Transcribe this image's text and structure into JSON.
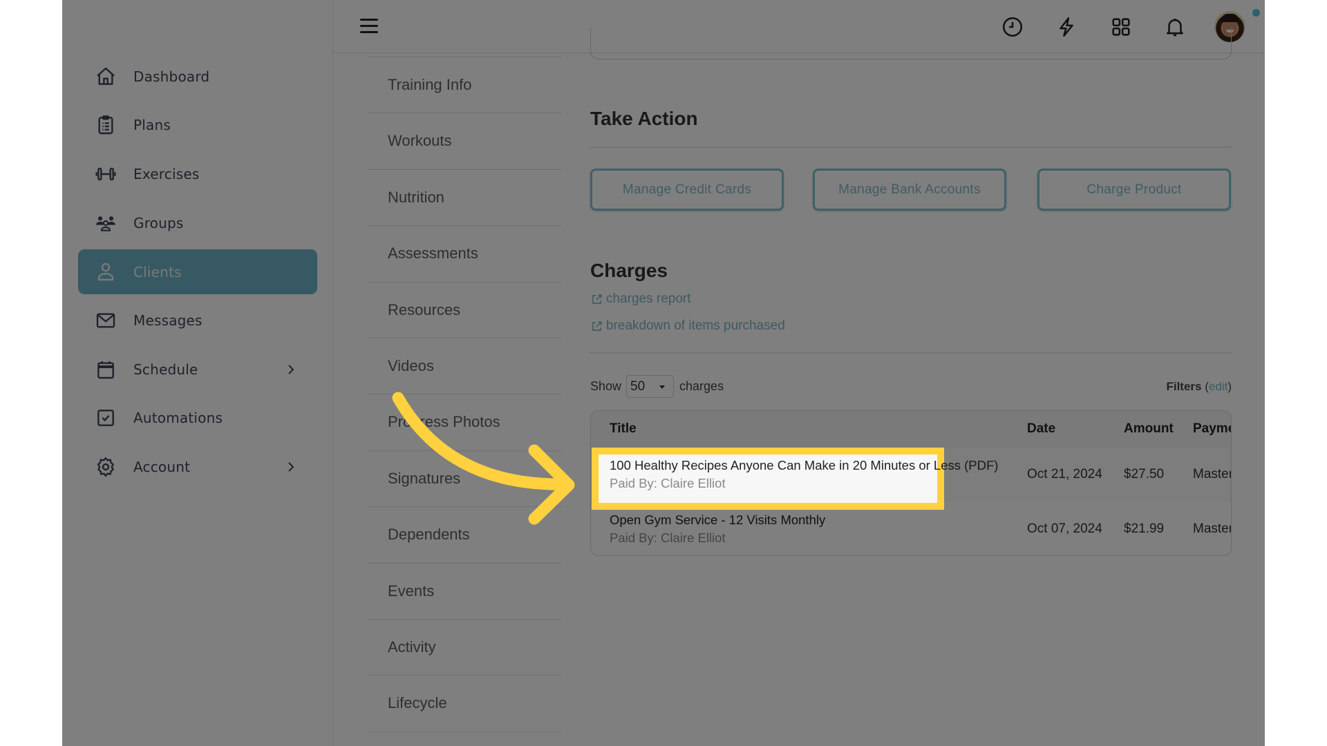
{
  "sidebar": {
    "items": [
      {
        "label": "Dashboard",
        "icon": "home-icon"
      },
      {
        "label": "Plans",
        "icon": "clipboard-icon"
      },
      {
        "label": "Exercises",
        "icon": "dumbbell-icon"
      },
      {
        "label": "Groups",
        "icon": "users-icon"
      },
      {
        "label": "Clients",
        "icon": "user-icon",
        "active": true
      },
      {
        "label": "Messages",
        "icon": "envelope-icon"
      },
      {
        "label": "Schedule",
        "icon": "calendar-icon",
        "has_submenu": true
      },
      {
        "label": "Automations",
        "icon": "checkbox-icon"
      },
      {
        "label": "Account",
        "icon": "gear-icon",
        "has_submenu": true
      }
    ]
  },
  "header": {
    "icons": [
      "menu-icon",
      "clock-icon",
      "lightning-icon",
      "apps-grid-icon",
      "bell-icon"
    ],
    "notification_dot": true
  },
  "subnav": {
    "items": [
      "Training Info",
      "Workouts",
      "Nutrition",
      "Assessments",
      "Resources",
      "Videos",
      "Progress Photos",
      "Signatures",
      "Dependents",
      "Events",
      "Activity",
      "Lifecycle"
    ]
  },
  "take_action": {
    "title": "Take Action",
    "buttons": [
      "Manage Credit Cards",
      "Manage Bank Accounts",
      "Charge Product"
    ]
  },
  "charges": {
    "title": "Charges",
    "links": [
      "charges report",
      "breakdown of items purchased"
    ],
    "show_label": "Show",
    "page_size": "50",
    "page_size_suffix": "charges",
    "filters_label": "Filters",
    "filters_edit": "edit",
    "columns": [
      "Title",
      "Date",
      "Amount",
      "Payme"
    ],
    "rows": [
      {
        "title": "100 Healthy Recipes Anyone Can Make in 20 Minutes or Less (PDF)",
        "paid_by": "Paid By: Claire Elliot",
        "date": "Oct 21, 2024",
        "amount": "$27.50",
        "payment": "Master",
        "highlighted": true
      },
      {
        "title": "Open Gym Service - 12 Visits Monthly",
        "paid_by": "Paid By: Claire Elliot",
        "date": "Oct 07, 2024",
        "amount": "$21.99",
        "payment": "Master"
      }
    ]
  },
  "annotation": {
    "highlight_color": "#ffd13f",
    "arrow_color": "#ffd13f"
  },
  "colors": {
    "accent": "#6fb3c6"
  }
}
